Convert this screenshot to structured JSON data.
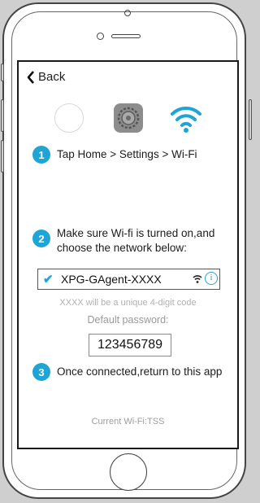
{
  "nav": {
    "back_label": "Back"
  },
  "icons": [
    "home-circle",
    "settings-gear-icon",
    "wifi-icon"
  ],
  "accent_color": "#1fa4d6",
  "steps": [
    {
      "number": "1",
      "text": "Tap Home > Settings > Wi-Fi"
    },
    {
      "number": "2",
      "text_line1": "Make sure Wi-fi is turned on,and",
      "text_line2": "choose the network below:"
    },
    {
      "number": "3",
      "text": "Once connected,return to this app"
    }
  ],
  "network": {
    "name": "XPG-GAgent-XXXX",
    "checked": true,
    "info_glyph": "i"
  },
  "hints": {
    "unique_code": "XXXX will be a unique 4-digit code",
    "default_password_label": "Default password:",
    "default_password": "123456789"
  },
  "current_wifi": "Current Wi-Fi:TSS"
}
